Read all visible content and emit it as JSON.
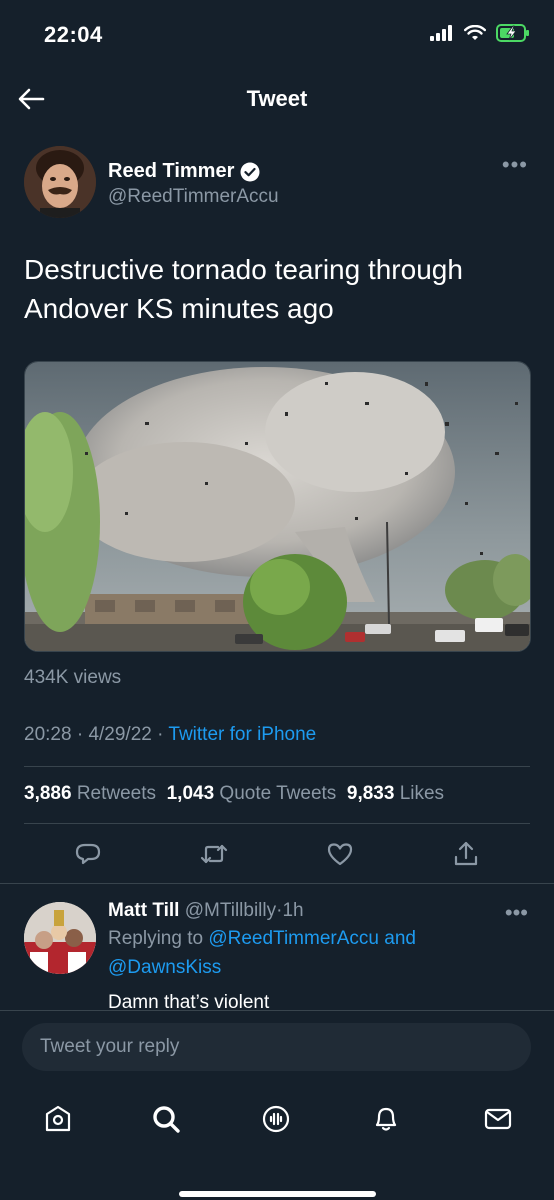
{
  "status_bar": {
    "time": "22:04",
    "icons": [
      "signal-icon",
      "wifi-icon",
      "battery-charging-icon"
    ],
    "battery_color": "#4cd964"
  },
  "nav": {
    "title": "Tweet",
    "back_icon": "arrow-left-icon"
  },
  "tweet": {
    "author_name": "Reed Timmer",
    "author_handle": "@ReedTimmerAccu",
    "verified": true,
    "text": "Destructive tornado tearing through Andover KS minutes ago",
    "media_description": "tornado-photo",
    "views": "434K views",
    "time": "20:28",
    "date": "4/29/22",
    "separator": "·",
    "source": "Twitter for iPhone",
    "stats": {
      "retweets_count": "3,886",
      "retweets_label": "Retweets",
      "quotes_count": "1,043",
      "quotes_label": "Quote Tweets",
      "likes_count": "9,833",
      "likes_label": "Likes"
    },
    "actions": [
      "reply-icon",
      "retweet-icon",
      "like-icon",
      "share-icon"
    ]
  },
  "reply": {
    "name": "Matt Till",
    "handle": "@MTillbilly",
    "age": "1h",
    "separator": "·",
    "replying_prefix": "Replying to",
    "replying_to_1": "@ReedTimmerAccu",
    "replying_joiner": "and",
    "replying_to_2": "@DawnsKiss",
    "text": "Damn that’s violent"
  },
  "composer": {
    "placeholder": "Tweet your reply"
  },
  "tab_bar": [
    "home-icon",
    "search-icon",
    "spaces-icon",
    "notifications-icon",
    "messages-icon"
  ],
  "colors": {
    "background": "#15202b",
    "accent": "#1d9bf0",
    "secondary_text": "#8b98a5",
    "divider": "#38444d"
  }
}
